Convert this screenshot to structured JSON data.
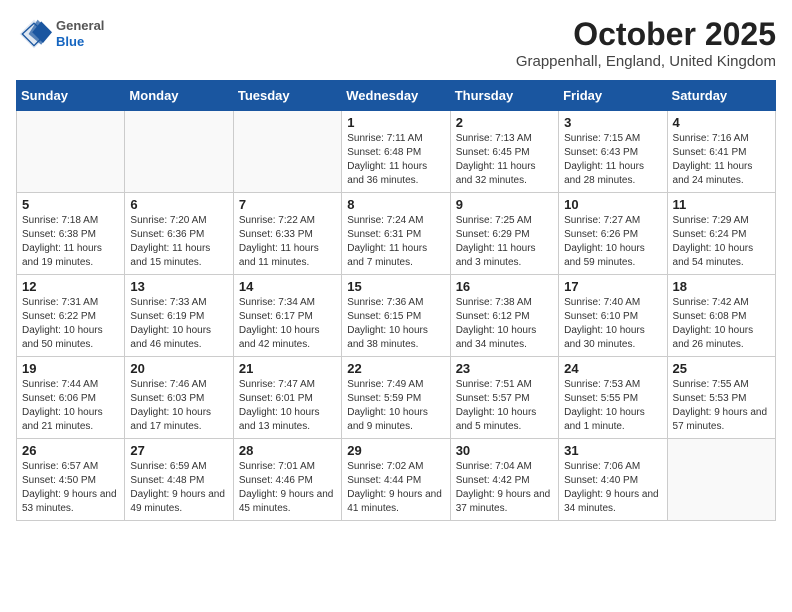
{
  "logo": {
    "general": "General",
    "blue": "Blue"
  },
  "title": "October 2025",
  "subtitle": "Grappenhall, England, United Kingdom",
  "days_of_week": [
    "Sunday",
    "Monday",
    "Tuesday",
    "Wednesday",
    "Thursday",
    "Friday",
    "Saturday"
  ],
  "weeks": [
    [
      {
        "day": "",
        "info": ""
      },
      {
        "day": "",
        "info": ""
      },
      {
        "day": "",
        "info": ""
      },
      {
        "day": "1",
        "info": "Sunrise: 7:11 AM\nSunset: 6:48 PM\nDaylight: 11 hours and 36 minutes."
      },
      {
        "day": "2",
        "info": "Sunrise: 7:13 AM\nSunset: 6:45 PM\nDaylight: 11 hours and 32 minutes."
      },
      {
        "day": "3",
        "info": "Sunrise: 7:15 AM\nSunset: 6:43 PM\nDaylight: 11 hours and 28 minutes."
      },
      {
        "day": "4",
        "info": "Sunrise: 7:16 AM\nSunset: 6:41 PM\nDaylight: 11 hours and 24 minutes."
      }
    ],
    [
      {
        "day": "5",
        "info": "Sunrise: 7:18 AM\nSunset: 6:38 PM\nDaylight: 11 hours and 19 minutes."
      },
      {
        "day": "6",
        "info": "Sunrise: 7:20 AM\nSunset: 6:36 PM\nDaylight: 11 hours and 15 minutes."
      },
      {
        "day": "7",
        "info": "Sunrise: 7:22 AM\nSunset: 6:33 PM\nDaylight: 11 hours and 11 minutes."
      },
      {
        "day": "8",
        "info": "Sunrise: 7:24 AM\nSunset: 6:31 PM\nDaylight: 11 hours and 7 minutes."
      },
      {
        "day": "9",
        "info": "Sunrise: 7:25 AM\nSunset: 6:29 PM\nDaylight: 11 hours and 3 minutes."
      },
      {
        "day": "10",
        "info": "Sunrise: 7:27 AM\nSunset: 6:26 PM\nDaylight: 10 hours and 59 minutes."
      },
      {
        "day": "11",
        "info": "Sunrise: 7:29 AM\nSunset: 6:24 PM\nDaylight: 10 hours and 54 minutes."
      }
    ],
    [
      {
        "day": "12",
        "info": "Sunrise: 7:31 AM\nSunset: 6:22 PM\nDaylight: 10 hours and 50 minutes."
      },
      {
        "day": "13",
        "info": "Sunrise: 7:33 AM\nSunset: 6:19 PM\nDaylight: 10 hours and 46 minutes."
      },
      {
        "day": "14",
        "info": "Sunrise: 7:34 AM\nSunset: 6:17 PM\nDaylight: 10 hours and 42 minutes."
      },
      {
        "day": "15",
        "info": "Sunrise: 7:36 AM\nSunset: 6:15 PM\nDaylight: 10 hours and 38 minutes."
      },
      {
        "day": "16",
        "info": "Sunrise: 7:38 AM\nSunset: 6:12 PM\nDaylight: 10 hours and 34 minutes."
      },
      {
        "day": "17",
        "info": "Sunrise: 7:40 AM\nSunset: 6:10 PM\nDaylight: 10 hours and 30 minutes."
      },
      {
        "day": "18",
        "info": "Sunrise: 7:42 AM\nSunset: 6:08 PM\nDaylight: 10 hours and 26 minutes."
      }
    ],
    [
      {
        "day": "19",
        "info": "Sunrise: 7:44 AM\nSunset: 6:06 PM\nDaylight: 10 hours and 21 minutes."
      },
      {
        "day": "20",
        "info": "Sunrise: 7:46 AM\nSunset: 6:03 PM\nDaylight: 10 hours and 17 minutes."
      },
      {
        "day": "21",
        "info": "Sunrise: 7:47 AM\nSunset: 6:01 PM\nDaylight: 10 hours and 13 minutes."
      },
      {
        "day": "22",
        "info": "Sunrise: 7:49 AM\nSunset: 5:59 PM\nDaylight: 10 hours and 9 minutes."
      },
      {
        "day": "23",
        "info": "Sunrise: 7:51 AM\nSunset: 5:57 PM\nDaylight: 10 hours and 5 minutes."
      },
      {
        "day": "24",
        "info": "Sunrise: 7:53 AM\nSunset: 5:55 PM\nDaylight: 10 hours and 1 minute."
      },
      {
        "day": "25",
        "info": "Sunrise: 7:55 AM\nSunset: 5:53 PM\nDaylight: 9 hours and 57 minutes."
      }
    ],
    [
      {
        "day": "26",
        "info": "Sunrise: 6:57 AM\nSunset: 4:50 PM\nDaylight: 9 hours and 53 minutes."
      },
      {
        "day": "27",
        "info": "Sunrise: 6:59 AM\nSunset: 4:48 PM\nDaylight: 9 hours and 49 minutes."
      },
      {
        "day": "28",
        "info": "Sunrise: 7:01 AM\nSunset: 4:46 PM\nDaylight: 9 hours and 45 minutes."
      },
      {
        "day": "29",
        "info": "Sunrise: 7:02 AM\nSunset: 4:44 PM\nDaylight: 9 hours and 41 minutes."
      },
      {
        "day": "30",
        "info": "Sunrise: 7:04 AM\nSunset: 4:42 PM\nDaylight: 9 hours and 37 minutes."
      },
      {
        "day": "31",
        "info": "Sunrise: 7:06 AM\nSunset: 4:40 PM\nDaylight: 9 hours and 34 minutes."
      },
      {
        "day": "",
        "info": ""
      }
    ]
  ]
}
